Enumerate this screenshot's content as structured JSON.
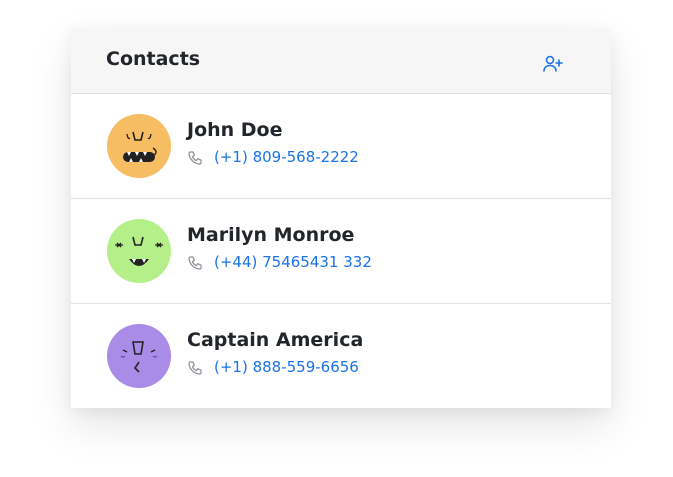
{
  "header": {
    "title": "Contacts",
    "add_icon": "add-user-icon"
  },
  "colors": {
    "accent": "#1a73e8",
    "avatar_john": "#f7bd62",
    "avatar_marilyn": "#b5ef8a",
    "avatar_captain": "#a88ce8"
  },
  "contacts": [
    {
      "name": "John Doe",
      "phone": "(+1) 809-568-2222",
      "avatar_color": "#f7bd62"
    },
    {
      "name": "Marilyn Monroe",
      "phone": "(+44) 75465431 332",
      "avatar_color": "#b5ef8a"
    },
    {
      "name": "Captain America",
      "phone": "(+1) 888-559-6656",
      "avatar_color": "#a88ce8"
    }
  ]
}
